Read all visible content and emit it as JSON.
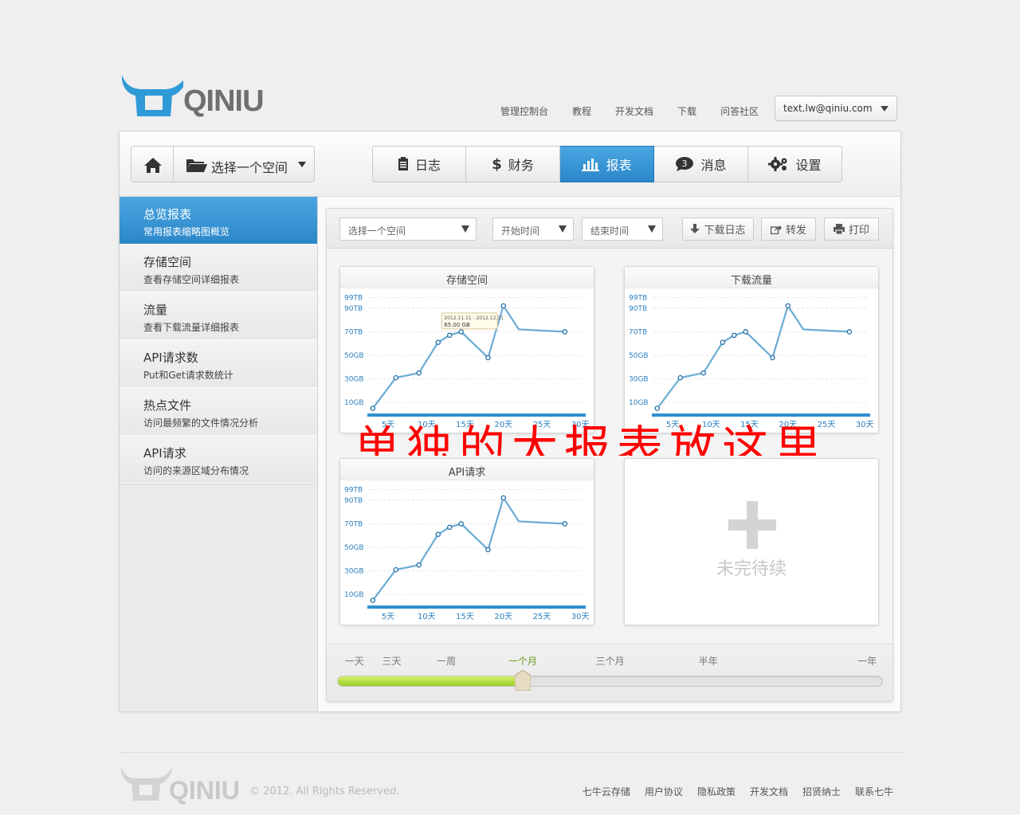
{
  "brand": {
    "name": "QINIU"
  },
  "topnav": [
    "管理控制台",
    "教程",
    "开发文档",
    "下载",
    "问答社区"
  ],
  "user": {
    "email": "text.lw@qiniu.com"
  },
  "toolbar": {
    "space_label": "选择一个空间",
    "tabs": [
      {
        "label": "日志",
        "icon": "clipboard-icon"
      },
      {
        "label": "财务",
        "icon": "dollar-icon"
      },
      {
        "label": "报表",
        "icon": "bar-chart-icon",
        "active": true
      },
      {
        "label": "消息",
        "icon": "chat-bubble-icon",
        "badge": "3"
      },
      {
        "label": "设置",
        "icon": "gears-icon"
      }
    ]
  },
  "sidebar": {
    "items": [
      {
        "title": "总览报表",
        "sub": "常用报表缩略图概览",
        "active": true
      },
      {
        "title": "存储空间",
        "sub": "查看存储空间详细报表"
      },
      {
        "title": "流量",
        "sub": "查看下载流量详细报表"
      },
      {
        "title": "API请求数",
        "sub": "Put和Get请求数统计"
      },
      {
        "title": "热点文件",
        "sub": "访问最频繁的文件情况分析"
      },
      {
        "title": "API请求",
        "sub": "访问的来源区域分布情况"
      }
    ]
  },
  "filters": {
    "space": "选择一个空间",
    "start": "开始时间",
    "end": "结束时间",
    "download_label": "下载日志",
    "share_label": "转发",
    "print_label": "打印"
  },
  "placeholder": {
    "text": "未完待续"
  },
  "overlay": {
    "text": "单独的大报表放这里"
  },
  "slider": {
    "labels": [
      "一天",
      "三天",
      "一周",
      "一个月",
      "三个月",
      "半年",
      "一年"
    ],
    "selected": "一个月",
    "value_fraction": 0.34
  },
  "chart_data": [
    {
      "type": "line",
      "title": "存储空间",
      "x": [
        3,
        6,
        9,
        11.5,
        13,
        14.5,
        18,
        20,
        22,
        28
      ],
      "y": [
        5,
        31,
        35,
        61,
        67,
        70,
        48,
        92,
        72,
        70
      ],
      "ylim": [
        0,
        100
      ],
      "y_ticks": [
        10,
        30,
        50,
        70,
        90,
        99
      ],
      "y_tick_labels": [
        "10GB",
        "30GB",
        "50GB",
        "70TB",
        "90TB",
        "99TB"
      ],
      "x_ticks": [
        5,
        10,
        15,
        20,
        25,
        30
      ],
      "x_tick_labels": [
        "5天",
        "10天",
        "15天",
        "20天",
        "25天",
        "30天"
      ],
      "xlim": [
        2.5,
        30.5
      ],
      "tooltip": {
        "line1": "2012.11.11 - 2012.12.11",
        "line2": "65.00 GB"
      },
      "color": "#6aacd5"
    },
    {
      "type": "line",
      "title": "下载流量",
      "x": [
        3,
        6,
        9,
        11.5,
        13,
        14.5,
        18,
        20,
        22,
        28
      ],
      "y": [
        5,
        31,
        35,
        61,
        67,
        70,
        48,
        92,
        72,
        70
      ],
      "ylim": [
        0,
        100
      ],
      "y_ticks": [
        10,
        30,
        50,
        70,
        90,
        99
      ],
      "y_tick_labels": [
        "10GB",
        "30GB",
        "50GB",
        "70TB",
        "90TB",
        "99TB"
      ],
      "x_ticks": [
        5,
        10,
        15,
        20,
        25,
        30
      ],
      "x_tick_labels": [
        "5天",
        "10天",
        "15天",
        "20天",
        "25天",
        "30天"
      ],
      "xlim": [
        2.5,
        30.5
      ],
      "color": "#6aacd5"
    },
    {
      "type": "line",
      "title": "API请求",
      "x": [
        3,
        6,
        9,
        11.5,
        13,
        14.5,
        18,
        20,
        22,
        28
      ],
      "y": [
        5,
        31,
        35,
        61,
        67,
        70,
        48,
        92,
        72,
        70
      ],
      "ylim": [
        0,
        100
      ],
      "y_ticks": [
        10,
        30,
        50,
        70,
        90,
        99
      ],
      "y_tick_labels": [
        "10GB",
        "30GB",
        "50GB",
        "70TB",
        "90TB",
        "99TB"
      ],
      "x_ticks": [
        5,
        10,
        15,
        20,
        25,
        30
      ],
      "x_tick_labels": [
        "5天",
        "10天",
        "15天",
        "20天",
        "25天",
        "30天"
      ],
      "xlim": [
        2.5,
        30.5
      ],
      "color": "#6aacd5"
    }
  ],
  "footer": {
    "copyright": "© 2012. All Rights Reserved.",
    "links": [
      "七牛云存储",
      "用户协议",
      "隐私政策",
      "开发文档",
      "招贤纳士",
      "联系七牛"
    ]
  },
  "colors": {
    "accent": "#2b87c9",
    "line": "#6aacd5",
    "slider_fill": "#9ccc2a",
    "overlay": "#ff0000"
  }
}
